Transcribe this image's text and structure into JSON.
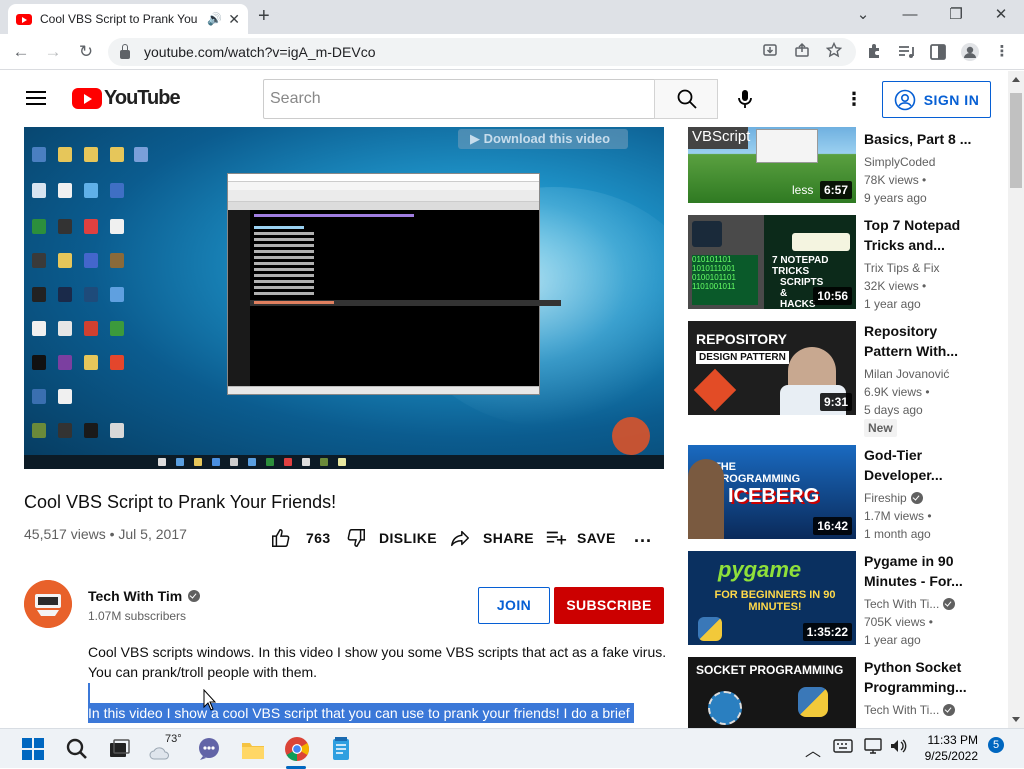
{
  "browser": {
    "tab_title": "Cool VBS Script to Prank You",
    "url": "youtube.com/watch?v=igA_m-DEVco"
  },
  "youtube": {
    "logo_text": "YouTube",
    "search_placeholder": "Search",
    "sign_in": "SIGN IN"
  },
  "video": {
    "overlay_banner": "Download this video",
    "title": "Cool VBS Script to Prank Your Friends!",
    "views_date": "45,517 views • Jul 5, 2017",
    "like_count": "763",
    "dislike_label": "DISLIKE",
    "share_label": "SHARE",
    "save_label": "SAVE",
    "more_label": "..."
  },
  "channel": {
    "name": "Tech With Tim",
    "subscribers": "1.07M subscribers",
    "join_label": "JOIN",
    "subscribe_label": "SUBSCRIBE"
  },
  "description": {
    "text": "Cool VBS scripts windows. In this video I show you some VBS scripts that act as a fake virus. You can prank/troll people with them.",
    "selected_text": "In this video I show a cool VBS script that you can use to prank your friends! I do a brief"
  },
  "recommendations": [
    {
      "title": "Basics, Part 8 ...",
      "channel": "SimplyCoded",
      "verified": false,
      "views": "78K views •",
      "age": "9 years ago",
      "duration": "6:57",
      "thumb_text": "VBScript",
      "thumb_caption": "less",
      "badge": ""
    },
    {
      "title": "Top 7 Notepad Tricks and...",
      "channel": "Trix Tips & Fix",
      "verified": false,
      "views": "32K views •",
      "age": "1 year ago",
      "duration": "10:56",
      "thumb_text": "7 NOTEPAD TRICKS",
      "thumb_caption": "SCRIPTS & HACKS",
      "badge": ""
    },
    {
      "title": "Repository Pattern With...",
      "channel": "Milan Jovanović",
      "verified": false,
      "views": "6.9K views •",
      "age": "5 days ago",
      "duration": "9:31",
      "thumb_text": "REPOSITORY",
      "thumb_caption": "DESIGN PATTERN",
      "badge": "New"
    },
    {
      "title": "God-Tier Developer...",
      "channel": "Fireship",
      "verified": true,
      "views": "1.7M views •",
      "age": "1 month ago",
      "duration": "16:42",
      "thumb_text": "THE PROGRAMMING",
      "thumb_caption": "ICEBERG",
      "badge": ""
    },
    {
      "title": "Pygame in 90 Minutes - For...",
      "channel": "Tech With Ti...",
      "verified": true,
      "views": "705K views •",
      "age": "1 year ago",
      "duration": "1:35:22",
      "thumb_text": "pygame",
      "thumb_caption": "FOR BEGINNERS IN 90 MINUTES!",
      "badge": ""
    },
    {
      "title": "Python Socket Programming...",
      "channel": "Tech With Ti...",
      "verified": true,
      "views": "",
      "age": "",
      "duration": "",
      "thumb_text": "SOCKET PROGRAMMING",
      "thumb_caption": "",
      "badge": ""
    }
  ],
  "taskbar": {
    "weather": "73°",
    "time": "11:33 PM",
    "date": "9/25/2022",
    "notifications": "5"
  }
}
